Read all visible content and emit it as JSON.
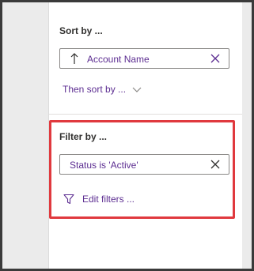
{
  "sort": {
    "title": "Sort by ...",
    "field_label": "Account Name",
    "then_sort_label": "Then sort by ..."
  },
  "filter": {
    "title": "Filter by ...",
    "condition_label": "Status is 'Active'",
    "edit_filters_label": "Edit filters ..."
  },
  "colors": {
    "accent": "#5c2d91",
    "highlight": "#e0393e"
  }
}
